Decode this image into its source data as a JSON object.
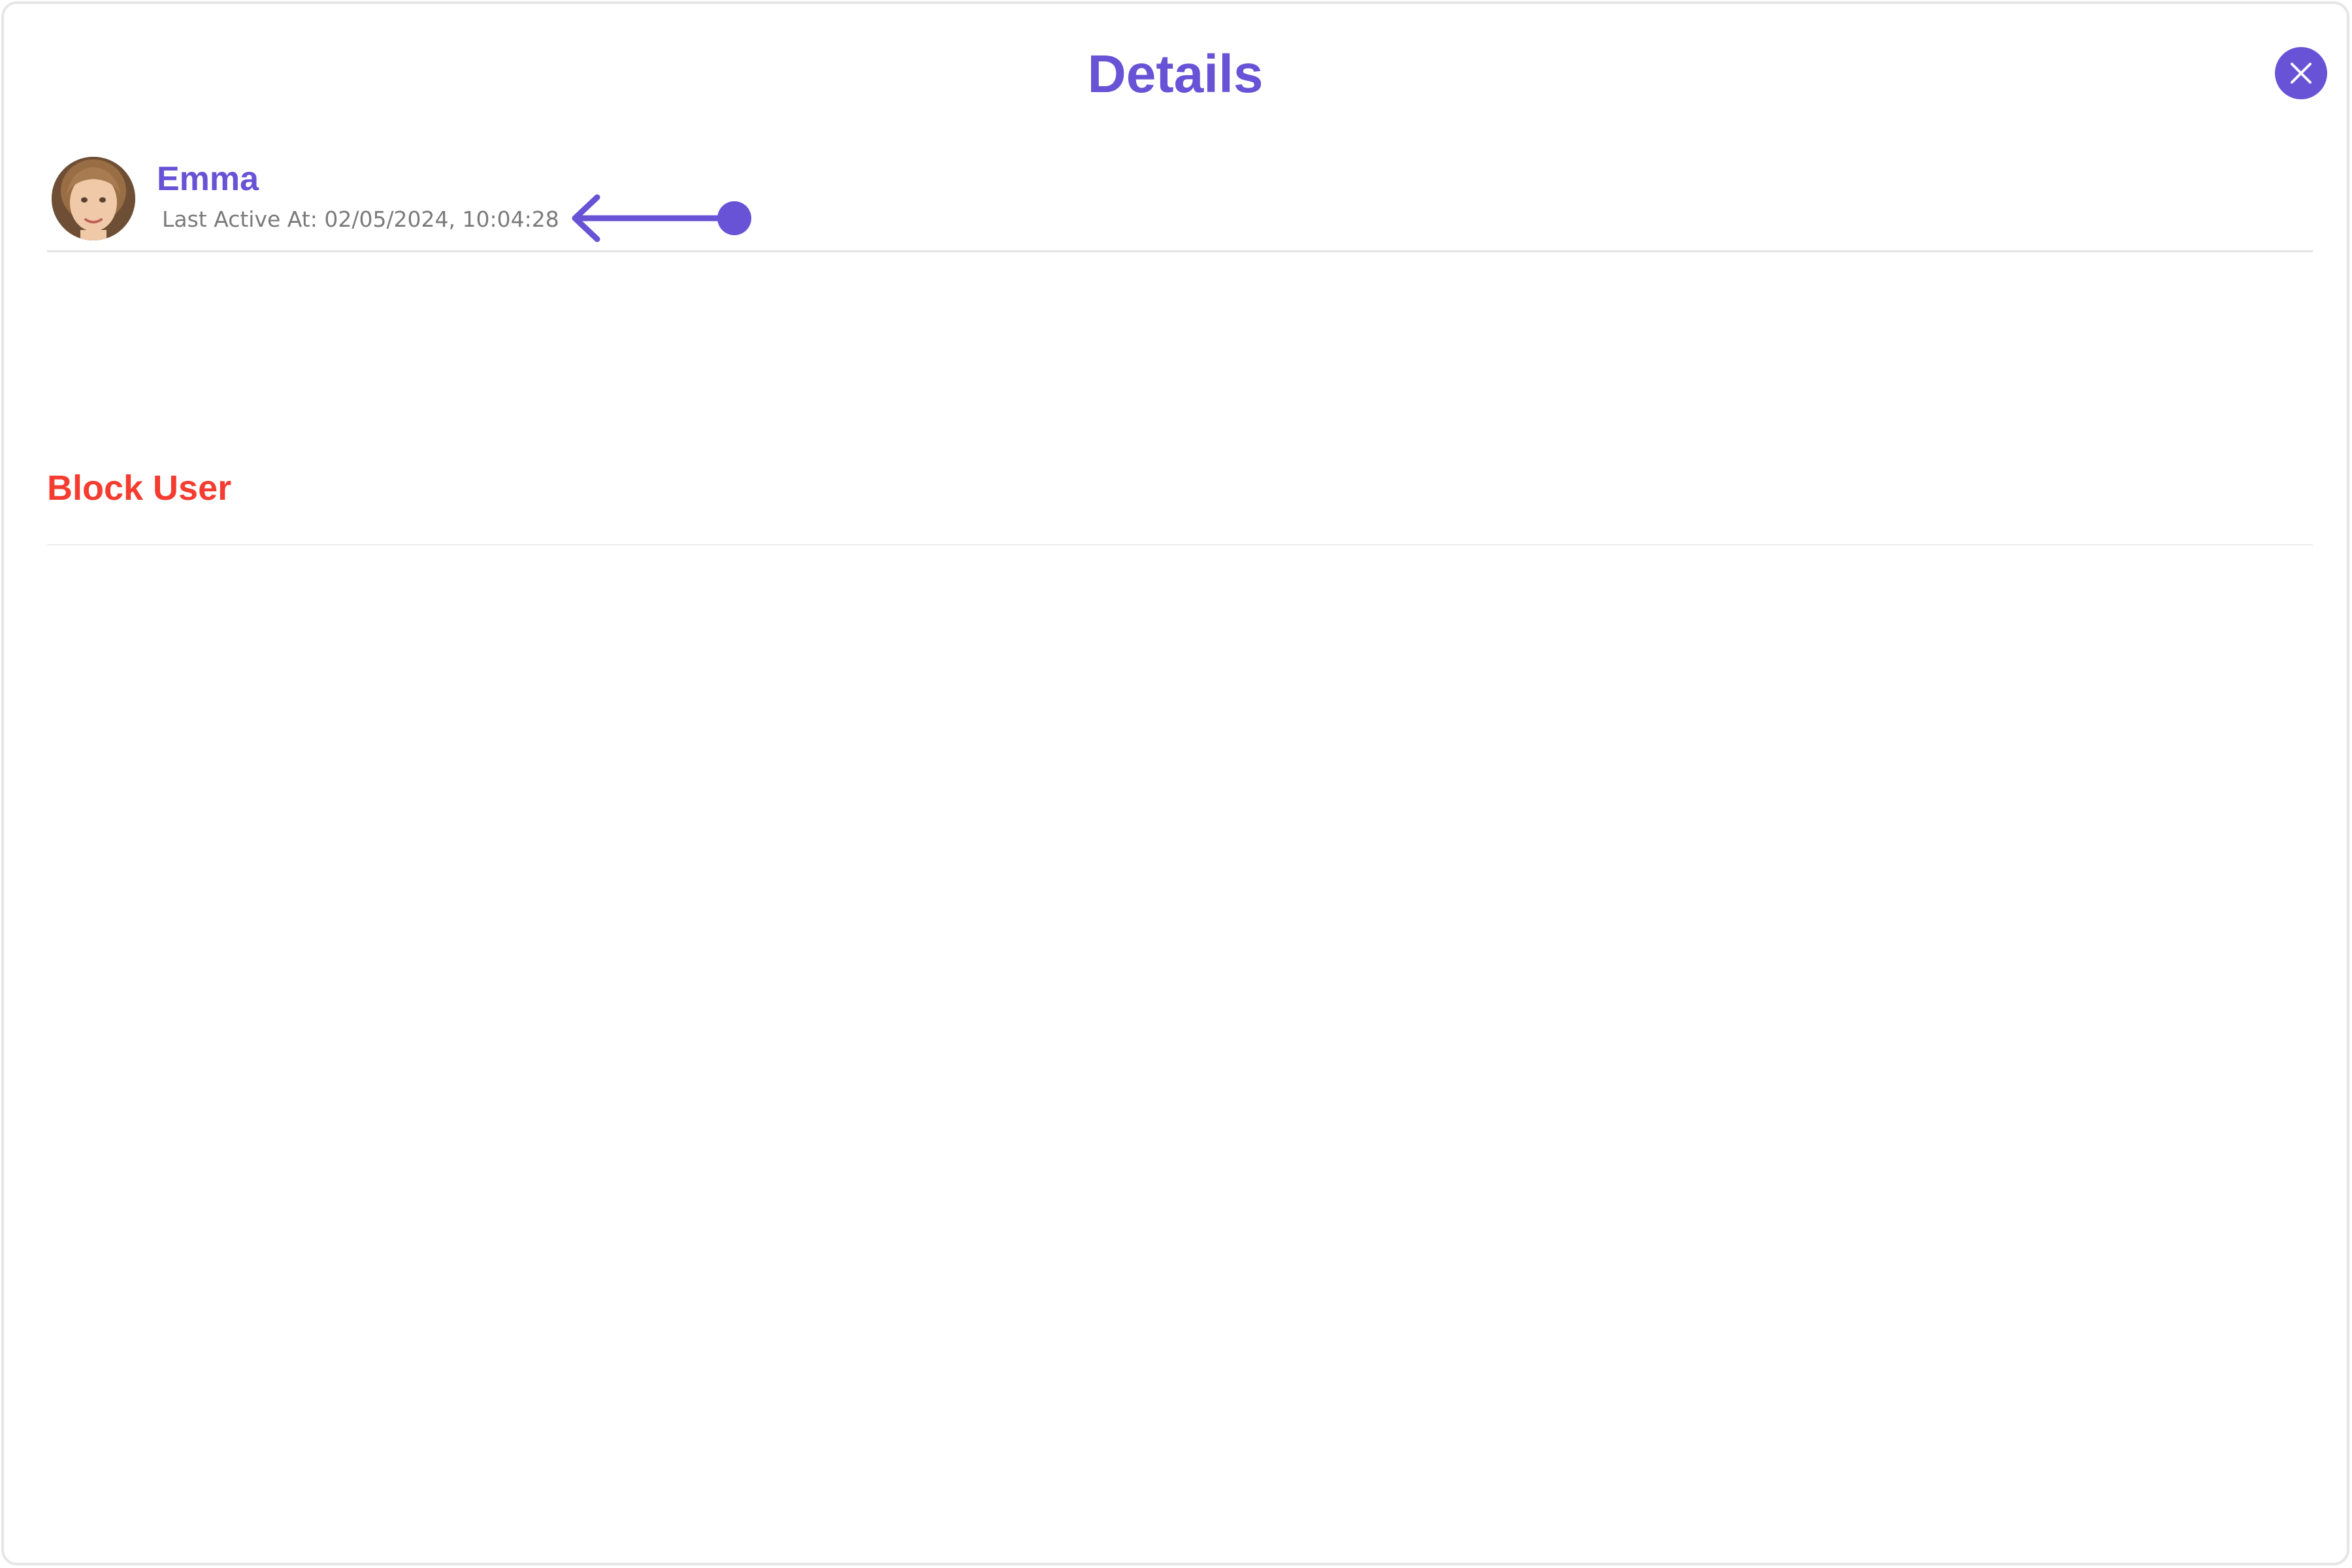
{
  "header": {
    "title": "Details",
    "close_icon": "close-icon"
  },
  "user": {
    "name": "Emma",
    "status_text": "Last Active At: 02/05/2024, 10:04:28",
    "avatar_icon": "user-avatar"
  },
  "annotation": {
    "icon": "arrow-left-pointer-icon",
    "color": "#6852d6"
  },
  "actions": {
    "block_user_label": "Block User",
    "block_user_color": "#f43c30"
  },
  "colors": {
    "accent": "#6852d6",
    "danger": "#f43c30",
    "muted_text": "#7a7a7a",
    "divider": "#e4e4e4"
  }
}
